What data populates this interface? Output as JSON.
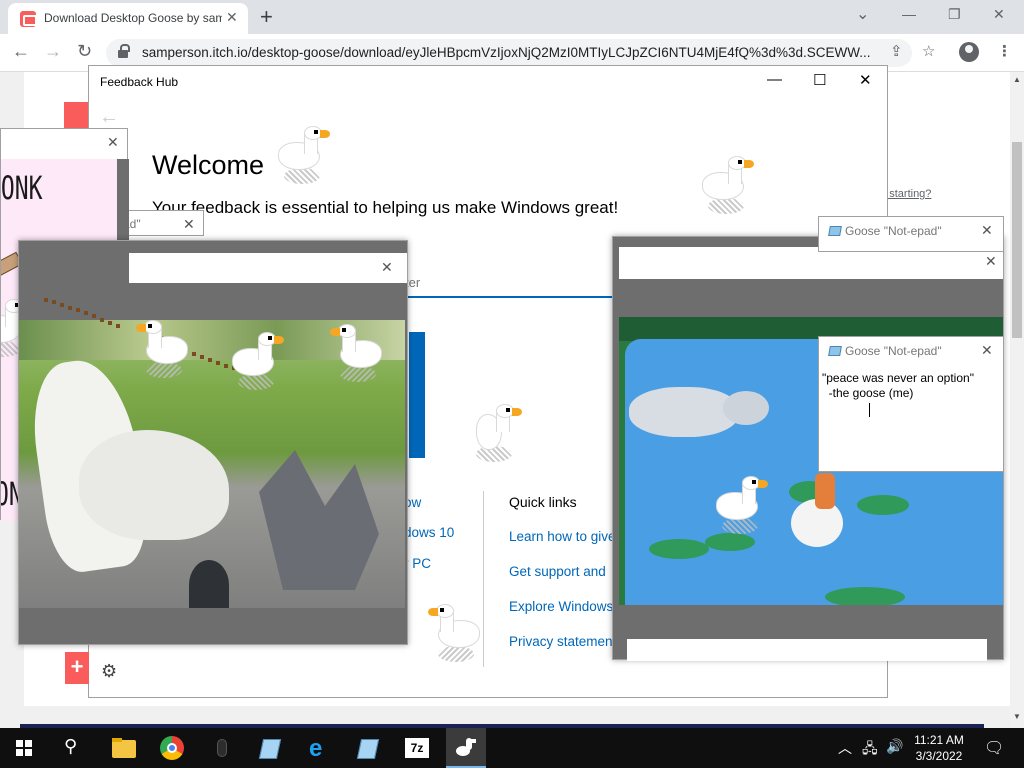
{
  "browser": {
    "tab_title": "Download Desktop Goose by samperson",
    "tab_close": "✕",
    "new_tab": "+",
    "url": "samperson.itch.io/desktop-goose/download/eyJleHBpcmVzIjoxNjQ2MzI0MTIyLCJpZCI6NTU4MjE4fQ%3d%3d.SCEWW...",
    "page_link": "ot starting?",
    "ctl_minimize": "—",
    "ctl_restore": "❐",
    "ctl_close": "✕",
    "ctl_tabsearch": "⌄"
  },
  "feedback_hub": {
    "title": "Feedback Hub",
    "welcome": "Welcome",
    "subtitle": "Your feedback is essential to helping us make Windows great!",
    "search_placeholder": "ter",
    "links_left": [
      "ow",
      "dows 10",
      "r PC"
    ],
    "quick_links_heading": "Quick links",
    "quick_links": [
      "Learn how to give",
      "Get support and",
      "Explore Windows",
      "Privacy statement"
    ],
    "ctl_minimize": "—",
    "ctl_maximize": "☐",
    "ctl_close": "✕",
    "back": "←",
    "gear": "⚙",
    "add": "+"
  },
  "goose": {
    "notepad_title": "Goose \"Not-epad\"",
    "ghost_title": "ad\"",
    "notepad_text": "\"peace was never an option\"\n  -the goose (me)",
    "honk_top": "HONK",
    "honk_bottom": "ONK",
    "close": "✕"
  },
  "taskbar": {
    "time": "11:21 AM",
    "date": "3/3/2022",
    "apps": [
      "file-explorer",
      "chrome",
      "mouse",
      "notepad",
      "internet-explorer",
      "notepad",
      "7zip",
      "desktop-goose"
    ],
    "label_7zip": "7z",
    "search_glyph": "⚲",
    "tray_chevron": "︿",
    "tray_network": "🖧",
    "tray_volume": "🔊",
    "tray_notification": "🗨"
  },
  "colors": {
    "accent_blue": "#0067b8",
    "itch_red": "#fa5c5c",
    "goose_beak": "#f5a623"
  }
}
